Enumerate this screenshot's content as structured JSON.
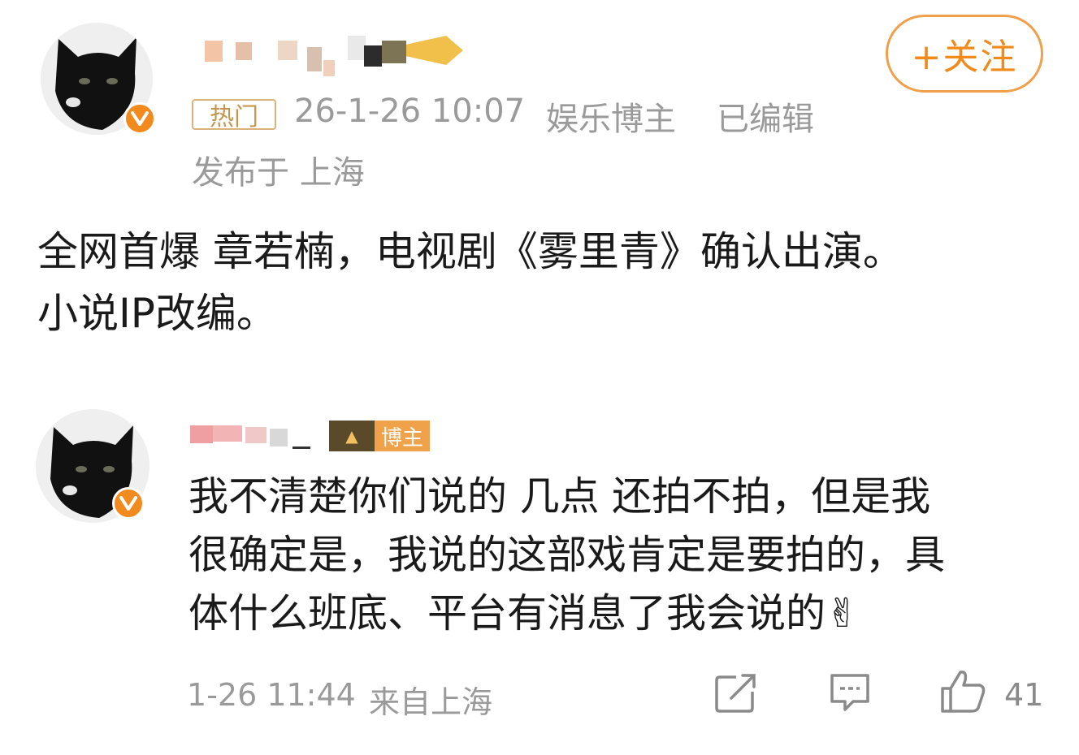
{
  "post": {
    "follow_label": "+关注",
    "hot_tag": "热门",
    "timestamp": "26-1-26 10:07",
    "author_role": "娱乐博主",
    "edited": "已编辑",
    "location": "发布于 上海",
    "text_line1": "全网首爆  章若楠，电视剧《雾里青》确认出演。",
    "text_line2": "小说IP改编。"
  },
  "comment": {
    "badge_label": "博主",
    "text_line1": "我不清楚你们说的 几点  还拍不拍，但是我",
    "text_line2": "很确定是，我说的这部戏肯定是要拍的，具",
    "text_line3": "体什么班底、平台有消息了我会说的✌",
    "timestamp": "1-26 11:44",
    "source": "来自上海",
    "like_count": "41"
  },
  "colors": {
    "accent": "#f08a1a",
    "verified": "#f28a1e",
    "meta_gray": "#9a9a9a",
    "hot_tag": "#c5964e"
  },
  "icons": {
    "verified": "verified-v-icon",
    "share": "share-icon",
    "comment": "comment-icon",
    "like": "thumbs-up-icon"
  }
}
